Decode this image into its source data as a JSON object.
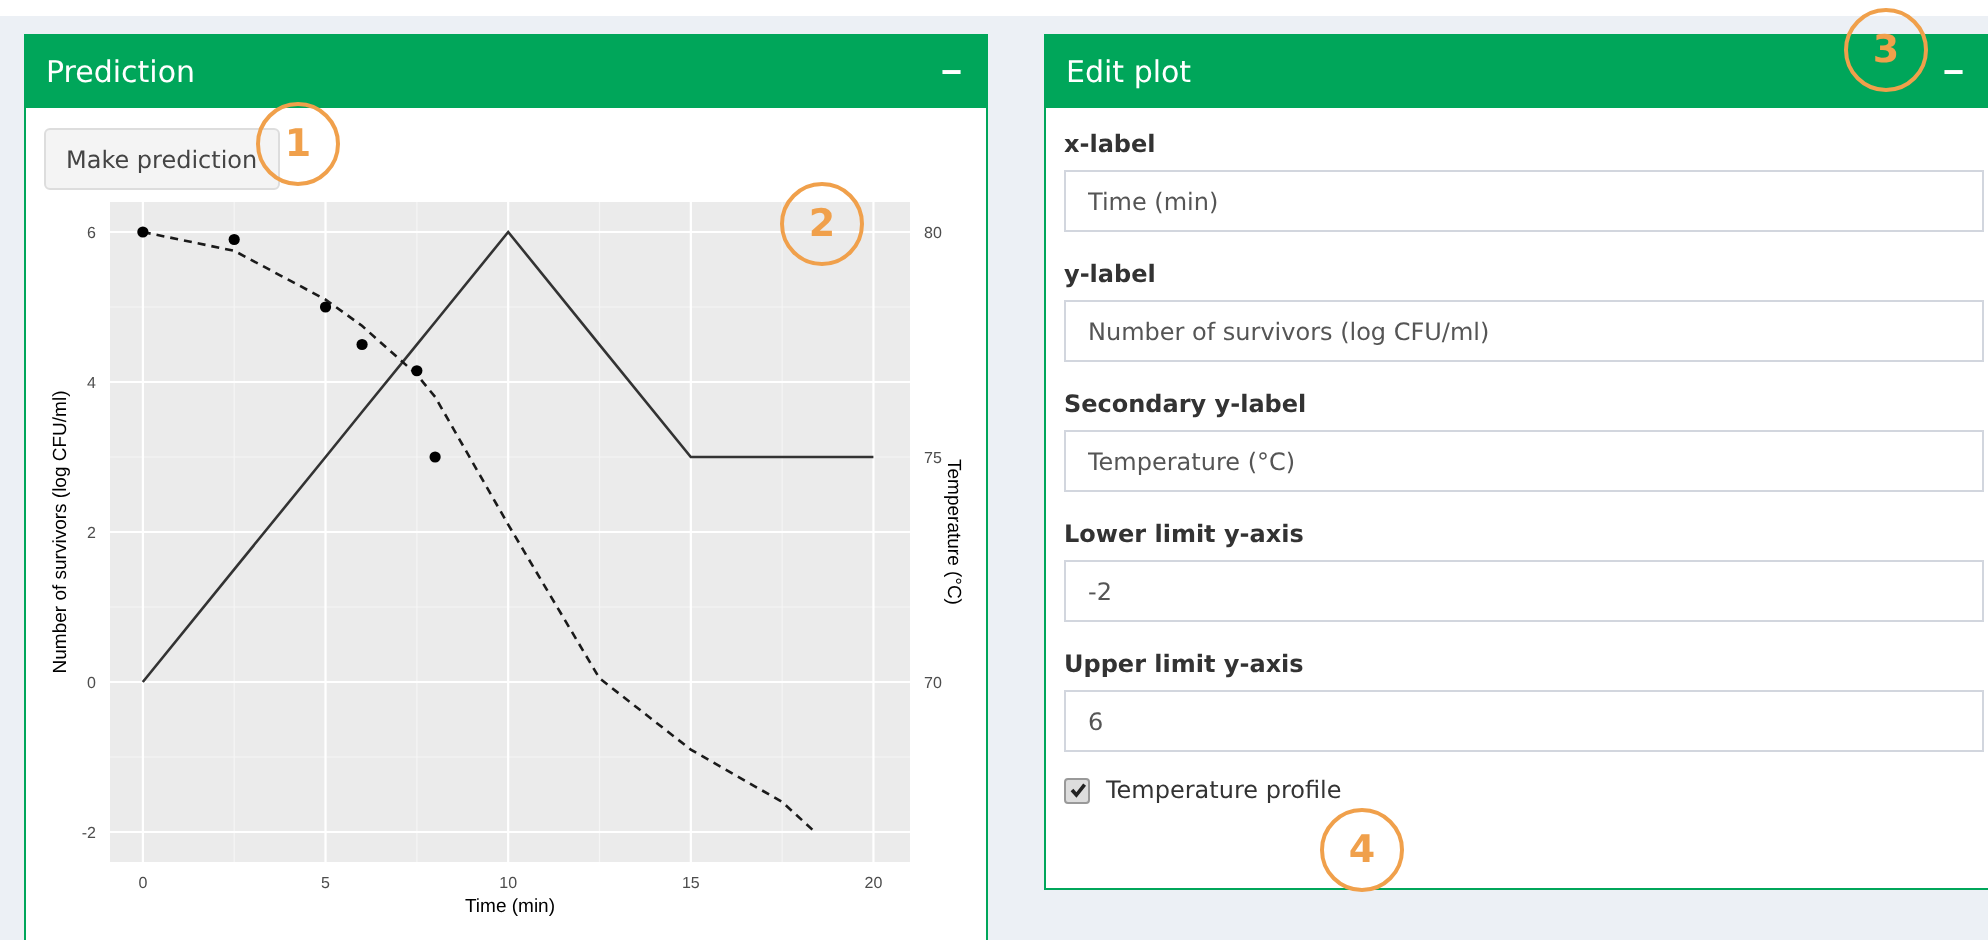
{
  "prediction_box": {
    "title": "Prediction",
    "collapse_icon": "−",
    "make_prediction_button": "Make prediction",
    "chart_data": {
      "type": "line",
      "xlabel": "Time (min)",
      "ylabel": "Number of survivors (log CFU/ml)",
      "x": [
        0,
        2.5,
        5,
        6,
        7.5,
        8,
        10,
        12.5,
        15,
        17.5,
        18.4,
        20
      ],
      "series": [
        {
          "color": "#333333",
          "line_style": "solid",
          "values": [
            0,
            1.5,
            3,
            3.6,
            4.5,
            4.8,
            6,
            4.5,
            3,
            3,
            3,
            3
          ]
        },
        {
          "color": "#1a1a1a",
          "line_style": "dashed",
          "values": [
            6,
            5.75,
            5.1,
            4.75,
            4.1,
            3.8,
            2.1,
            0.05,
            -0.9,
            -1.6,
            -2,
            null
          ]
        },
        {
          "type": "scatter",
          "color": "#000000",
          "marker": "circle",
          "values": [
            6,
            5.9,
            5,
            4.5,
            4.15,
            3,
            null,
            null,
            null,
            null,
            null,
            null
          ]
        }
      ],
      "xlim": [
        -0.9,
        21
      ],
      "ylim": [
        -2.4,
        6.4
      ],
      "xticks": [
        0,
        5,
        10,
        15,
        20
      ],
      "yticks": [
        -2,
        0,
        2,
        4,
        6
      ],
      "grid": true
    },
    "secondary_axis": {
      "title": "Temperature (°C)",
      "ticks": [
        "80",
        "75",
        "70"
      ]
    }
  },
  "edit_plot_box": {
    "title": "Edit plot",
    "collapse_icon": "−",
    "fields": [
      {
        "label": "x-label",
        "value": "Time (min)"
      },
      {
        "label": "y-label",
        "value": "Number of survivors (log CFU/ml)"
      },
      {
        "label": "Secondary y-label",
        "value": "Temperature (°C)"
      },
      {
        "label": "Lower limit y-axis",
        "value": "-2"
      },
      {
        "label": "Upper limit y-axis",
        "value": "6"
      }
    ],
    "checkbox": {
      "label": "Temperature profile",
      "checked": true
    }
  },
  "callouts": [
    "1",
    "2",
    "3",
    "4"
  ]
}
